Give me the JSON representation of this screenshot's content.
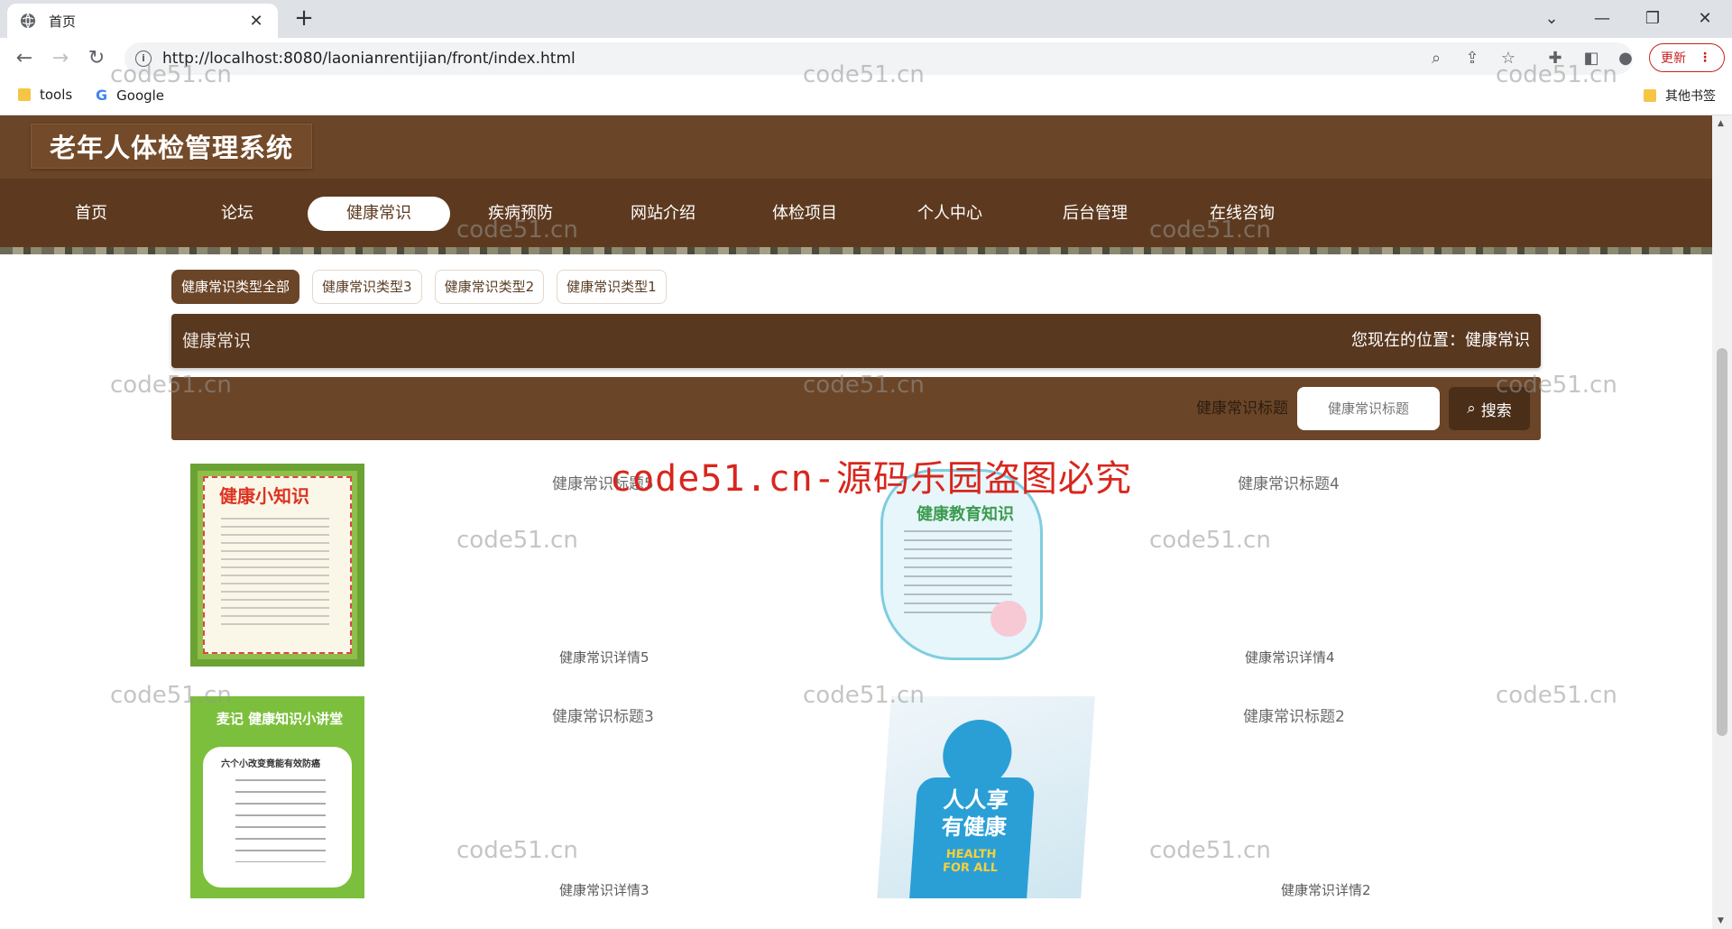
{
  "browser": {
    "tab_title": "首页",
    "url": "http://localhost:8080/laonianrentijian/front/index.html",
    "update_label": "更新",
    "bookmarks": [
      {
        "label": "tools"
      },
      {
        "label": "Google"
      }
    ],
    "other_bookmarks": "其他书签"
  },
  "site": {
    "title": "老年人体检管理系统",
    "nav": [
      {
        "label": "首页"
      },
      {
        "label": "论坛"
      },
      {
        "label": "健康常识",
        "active": true
      },
      {
        "label": "疾病预防"
      },
      {
        "label": "网站介绍"
      },
      {
        "label": "体检项目"
      },
      {
        "label": "个人中心"
      },
      {
        "label": "后台管理"
      },
      {
        "label": "在线咨询"
      }
    ]
  },
  "filters": [
    {
      "label": "健康常识类型全部",
      "active": true
    },
    {
      "label": "健康常识类型3"
    },
    {
      "label": "健康常识类型2"
    },
    {
      "label": "健康常识类型1"
    }
  ],
  "breadcrumb": {
    "title": "健康常识",
    "position": "您现在的位置：健康常识"
  },
  "search": {
    "label": "健康常识标题",
    "placeholder": "健康常识标题",
    "button": "搜索"
  },
  "cards": [
    {
      "title": "健康常识标题5",
      "detail": "健康常识详情5",
      "image_text": "健康小知识"
    },
    {
      "title": "健康常识标题4",
      "detail": "健康常识详情4",
      "image_text": "健康教育知识"
    },
    {
      "title": "健康常识标题3",
      "detail": "健康常识详情3",
      "image_text": "麦记 健康知识小讲堂",
      "image_subtext": "六个小改变竟能有效防癌"
    },
    {
      "title": "健康常识标题2",
      "detail": "健康常识详情2",
      "image_text": "人人享有健康",
      "image_subtext": "HEALTH FOR ALL"
    }
  ],
  "watermarks": {
    "small": "code51.cn",
    "big": "code51.cn-源码乐园盗图必究"
  },
  "colors": {
    "header": "#6b4527",
    "nav": "#5d3a1f",
    "accent_red": "#d8261d"
  }
}
